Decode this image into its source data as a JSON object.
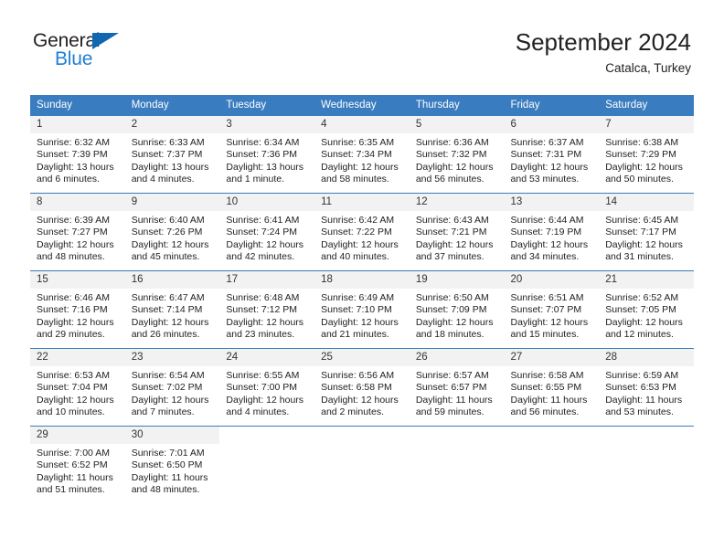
{
  "brand": {
    "name_part1": "General",
    "name_part2": "Blue",
    "triangle_color": "#1167b1",
    "blue_color": "#1f7fd4"
  },
  "header": {
    "title": "September 2024",
    "subtitle": "Catalca, Turkey"
  },
  "theme": {
    "header_row_bg": "#3a7cc0",
    "day_number_bg": "#f2f2f2",
    "row_border": "#3a7cc0"
  },
  "calendar": {
    "weekday_headers": [
      "Sunday",
      "Monday",
      "Tuesday",
      "Wednesday",
      "Thursday",
      "Friday",
      "Saturday"
    ],
    "weeks": [
      [
        {
          "day": "1",
          "sunrise": "Sunrise: 6:32 AM",
          "sunset": "Sunset: 7:39 PM",
          "daylight": "Daylight: 13 hours and 6 minutes."
        },
        {
          "day": "2",
          "sunrise": "Sunrise: 6:33 AM",
          "sunset": "Sunset: 7:37 PM",
          "daylight": "Daylight: 13 hours and 4 minutes."
        },
        {
          "day": "3",
          "sunrise": "Sunrise: 6:34 AM",
          "sunset": "Sunset: 7:36 PM",
          "daylight": "Daylight: 13 hours and 1 minute."
        },
        {
          "day": "4",
          "sunrise": "Sunrise: 6:35 AM",
          "sunset": "Sunset: 7:34 PM",
          "daylight": "Daylight: 12 hours and 58 minutes."
        },
        {
          "day": "5",
          "sunrise": "Sunrise: 6:36 AM",
          "sunset": "Sunset: 7:32 PM",
          "daylight": "Daylight: 12 hours and 56 minutes."
        },
        {
          "day": "6",
          "sunrise": "Sunrise: 6:37 AM",
          "sunset": "Sunset: 7:31 PM",
          "daylight": "Daylight: 12 hours and 53 minutes."
        },
        {
          "day": "7",
          "sunrise": "Sunrise: 6:38 AM",
          "sunset": "Sunset: 7:29 PM",
          "daylight": "Daylight: 12 hours and 50 minutes."
        }
      ],
      [
        {
          "day": "8",
          "sunrise": "Sunrise: 6:39 AM",
          "sunset": "Sunset: 7:27 PM",
          "daylight": "Daylight: 12 hours and 48 minutes."
        },
        {
          "day": "9",
          "sunrise": "Sunrise: 6:40 AM",
          "sunset": "Sunset: 7:26 PM",
          "daylight": "Daylight: 12 hours and 45 minutes."
        },
        {
          "day": "10",
          "sunrise": "Sunrise: 6:41 AM",
          "sunset": "Sunset: 7:24 PM",
          "daylight": "Daylight: 12 hours and 42 minutes."
        },
        {
          "day": "11",
          "sunrise": "Sunrise: 6:42 AM",
          "sunset": "Sunset: 7:22 PM",
          "daylight": "Daylight: 12 hours and 40 minutes."
        },
        {
          "day": "12",
          "sunrise": "Sunrise: 6:43 AM",
          "sunset": "Sunset: 7:21 PM",
          "daylight": "Daylight: 12 hours and 37 minutes."
        },
        {
          "day": "13",
          "sunrise": "Sunrise: 6:44 AM",
          "sunset": "Sunset: 7:19 PM",
          "daylight": "Daylight: 12 hours and 34 minutes."
        },
        {
          "day": "14",
          "sunrise": "Sunrise: 6:45 AM",
          "sunset": "Sunset: 7:17 PM",
          "daylight": "Daylight: 12 hours and 31 minutes."
        }
      ],
      [
        {
          "day": "15",
          "sunrise": "Sunrise: 6:46 AM",
          "sunset": "Sunset: 7:16 PM",
          "daylight": "Daylight: 12 hours and 29 minutes."
        },
        {
          "day": "16",
          "sunrise": "Sunrise: 6:47 AM",
          "sunset": "Sunset: 7:14 PM",
          "daylight": "Daylight: 12 hours and 26 minutes."
        },
        {
          "day": "17",
          "sunrise": "Sunrise: 6:48 AM",
          "sunset": "Sunset: 7:12 PM",
          "daylight": "Daylight: 12 hours and 23 minutes."
        },
        {
          "day": "18",
          "sunrise": "Sunrise: 6:49 AM",
          "sunset": "Sunset: 7:10 PM",
          "daylight": "Daylight: 12 hours and 21 minutes."
        },
        {
          "day": "19",
          "sunrise": "Sunrise: 6:50 AM",
          "sunset": "Sunset: 7:09 PM",
          "daylight": "Daylight: 12 hours and 18 minutes."
        },
        {
          "day": "20",
          "sunrise": "Sunrise: 6:51 AM",
          "sunset": "Sunset: 7:07 PM",
          "daylight": "Daylight: 12 hours and 15 minutes."
        },
        {
          "day": "21",
          "sunrise": "Sunrise: 6:52 AM",
          "sunset": "Sunset: 7:05 PM",
          "daylight": "Daylight: 12 hours and 12 minutes."
        }
      ],
      [
        {
          "day": "22",
          "sunrise": "Sunrise: 6:53 AM",
          "sunset": "Sunset: 7:04 PM",
          "daylight": "Daylight: 12 hours and 10 minutes."
        },
        {
          "day": "23",
          "sunrise": "Sunrise: 6:54 AM",
          "sunset": "Sunset: 7:02 PM",
          "daylight": "Daylight: 12 hours and 7 minutes."
        },
        {
          "day": "24",
          "sunrise": "Sunrise: 6:55 AM",
          "sunset": "Sunset: 7:00 PM",
          "daylight": "Daylight: 12 hours and 4 minutes."
        },
        {
          "day": "25",
          "sunrise": "Sunrise: 6:56 AM",
          "sunset": "Sunset: 6:58 PM",
          "daylight": "Daylight: 12 hours and 2 minutes."
        },
        {
          "day": "26",
          "sunrise": "Sunrise: 6:57 AM",
          "sunset": "Sunset: 6:57 PM",
          "daylight": "Daylight: 11 hours and 59 minutes."
        },
        {
          "day": "27",
          "sunrise": "Sunrise: 6:58 AM",
          "sunset": "Sunset: 6:55 PM",
          "daylight": "Daylight: 11 hours and 56 minutes."
        },
        {
          "day": "28",
          "sunrise": "Sunrise: 6:59 AM",
          "sunset": "Sunset: 6:53 PM",
          "daylight": "Daylight: 11 hours and 53 minutes."
        }
      ],
      [
        {
          "day": "29",
          "sunrise": "Sunrise: 7:00 AM",
          "sunset": "Sunset: 6:52 PM",
          "daylight": "Daylight: 11 hours and 51 minutes."
        },
        {
          "day": "30",
          "sunrise": "Sunrise: 7:01 AM",
          "sunset": "Sunset: 6:50 PM",
          "daylight": "Daylight: 11 hours and 48 minutes."
        },
        {
          "day": "",
          "sunrise": "",
          "sunset": "",
          "daylight": ""
        },
        {
          "day": "",
          "sunrise": "",
          "sunset": "",
          "daylight": ""
        },
        {
          "day": "",
          "sunrise": "",
          "sunset": "",
          "daylight": ""
        },
        {
          "day": "",
          "sunrise": "",
          "sunset": "",
          "daylight": ""
        },
        {
          "day": "",
          "sunrise": "",
          "sunset": "",
          "daylight": ""
        }
      ]
    ]
  }
}
